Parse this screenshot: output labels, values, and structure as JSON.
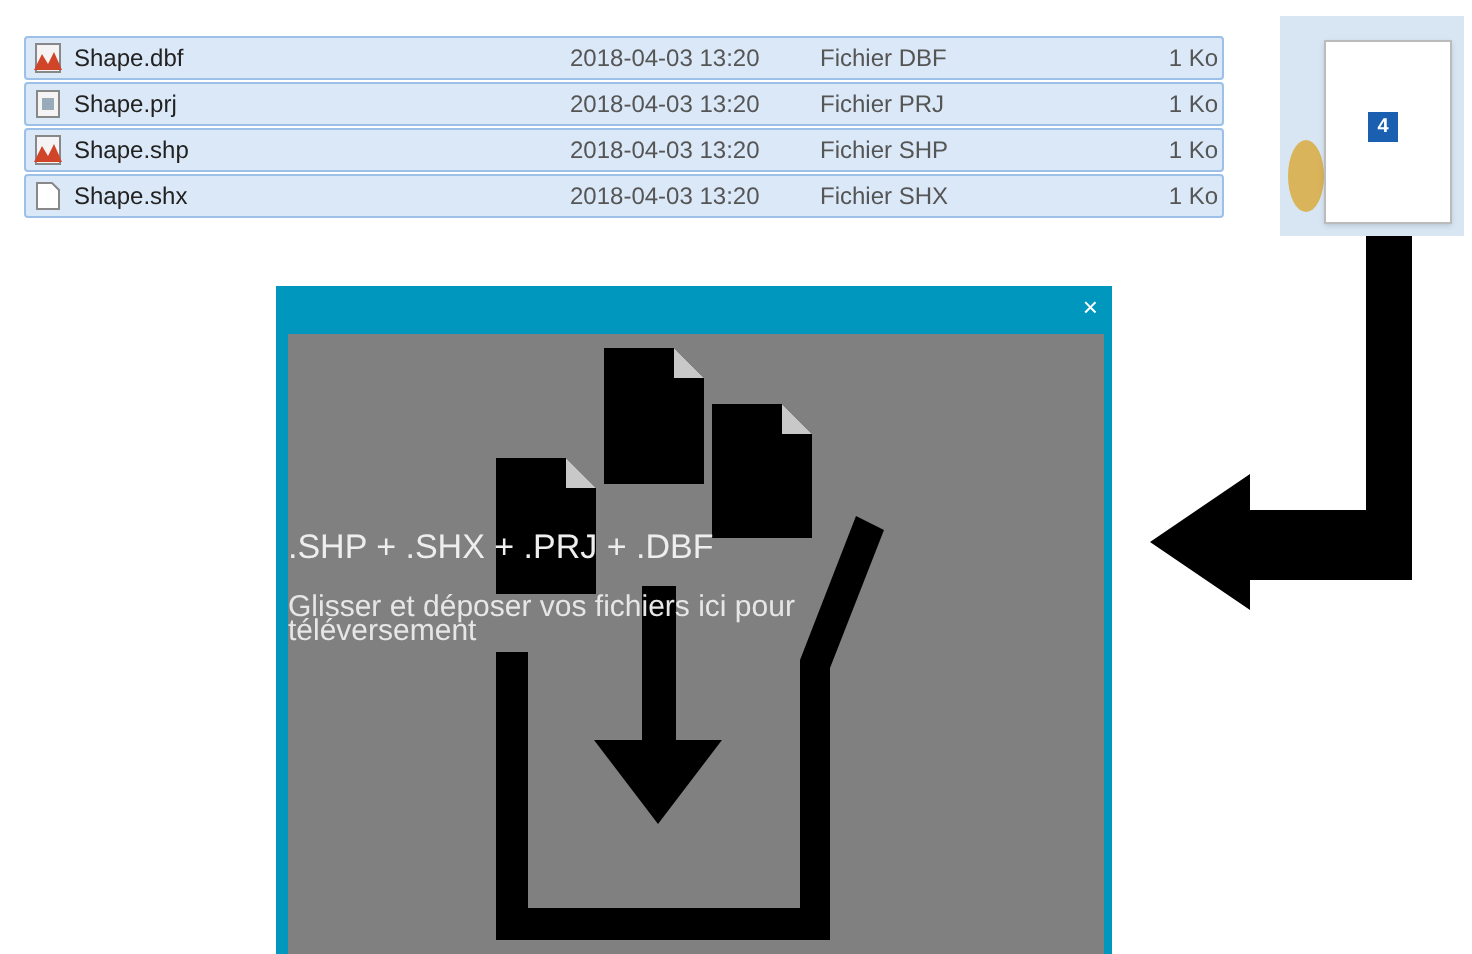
{
  "file_list": {
    "rows": [
      {
        "name": "Shape.dbf",
        "date": "2018-04-03 13:20",
        "type": "Fichier DBF",
        "size": "1 Ko",
        "selected": true,
        "kind": "shape"
      },
      {
        "name": "Shape.prj",
        "date": "2018-04-03 13:20",
        "type": "Fichier PRJ",
        "size": "1 Ko",
        "selected": true,
        "kind": "text"
      },
      {
        "name": "Shape.shp",
        "date": "2018-04-03 13:20",
        "type": "Fichier SHP",
        "size": "1 Ko",
        "selected": true,
        "kind": "shape"
      },
      {
        "name": "Shape.shx",
        "date": "2018-04-03 13:20",
        "type": "Fichier SHX",
        "size": "1 Ko",
        "selected": true,
        "kind": "blank"
      }
    ]
  },
  "drag_preview": {
    "count": "4"
  },
  "dialog": {
    "close": "×",
    "formats": ".SHP + .SHX + .PRJ + .DBF",
    "instructions": "Glisser et déposer vos fichiers ici pour téléversement"
  }
}
